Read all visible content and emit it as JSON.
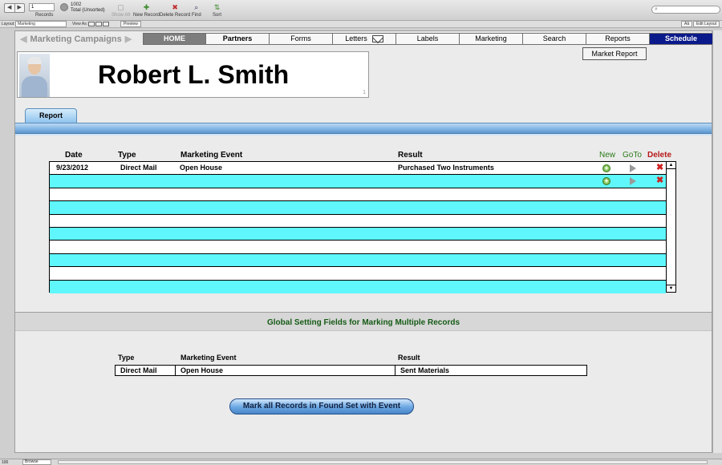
{
  "toolbar": {
    "record_number": "1",
    "records_label": "Records",
    "total_count": "1002",
    "total_label": "Total (Unsorted)",
    "show_all": "Show All",
    "new_record": "New Record",
    "delete_record": "Delete Record",
    "find": "Find",
    "sort": "Sort"
  },
  "layoutbar": {
    "layout_label": "Layout:",
    "layout_value": "Marketing",
    "view_as_label": "View As:",
    "preview": "Preview",
    "aa": "Aâ",
    "edit_layout": "Edit Layout"
  },
  "nav": {
    "section_title": "Marketing Campaigns",
    "tabs": [
      {
        "label": "HOME"
      },
      {
        "label": "Partners"
      },
      {
        "label": "Forms"
      },
      {
        "label": "Letters"
      },
      {
        "label": "Labels"
      },
      {
        "label": "Marketing"
      },
      {
        "label": "Search"
      },
      {
        "label": "Reports"
      },
      {
        "label": "Schedule"
      }
    ]
  },
  "market_report_button": "Market Report",
  "contact": {
    "name": "Robert L. Smith",
    "card_number": "1"
  },
  "report_tab": "Report",
  "portal": {
    "headers": {
      "date": "Date",
      "type": "Type",
      "event": "Marketing Event",
      "result": "Result",
      "new": "New",
      "goto": "GoTo",
      "delete": "Delete"
    },
    "rows": [
      {
        "date": "9/23/2012",
        "type": "Direct Mail",
        "event": "Open House",
        "result": "Purchased Two Instruments"
      }
    ]
  },
  "global_settings": {
    "title": "Global Setting Fields for Marking Multiple Records",
    "headers": {
      "type": "Type",
      "event": "Marketing Event",
      "result": "Result"
    },
    "type": "Direct Mail",
    "event": "Open House",
    "result": "Sent Materials",
    "button": "Mark all Records in Found Set with Event"
  },
  "statusbar": {
    "zoom": "100",
    "mode": "Browse"
  },
  "colors": {
    "alt_row": "#5ff7fc",
    "schedule_tab": "#0b1a8a",
    "home_tab": "#7d7d7d",
    "global_title": "#155a15"
  }
}
